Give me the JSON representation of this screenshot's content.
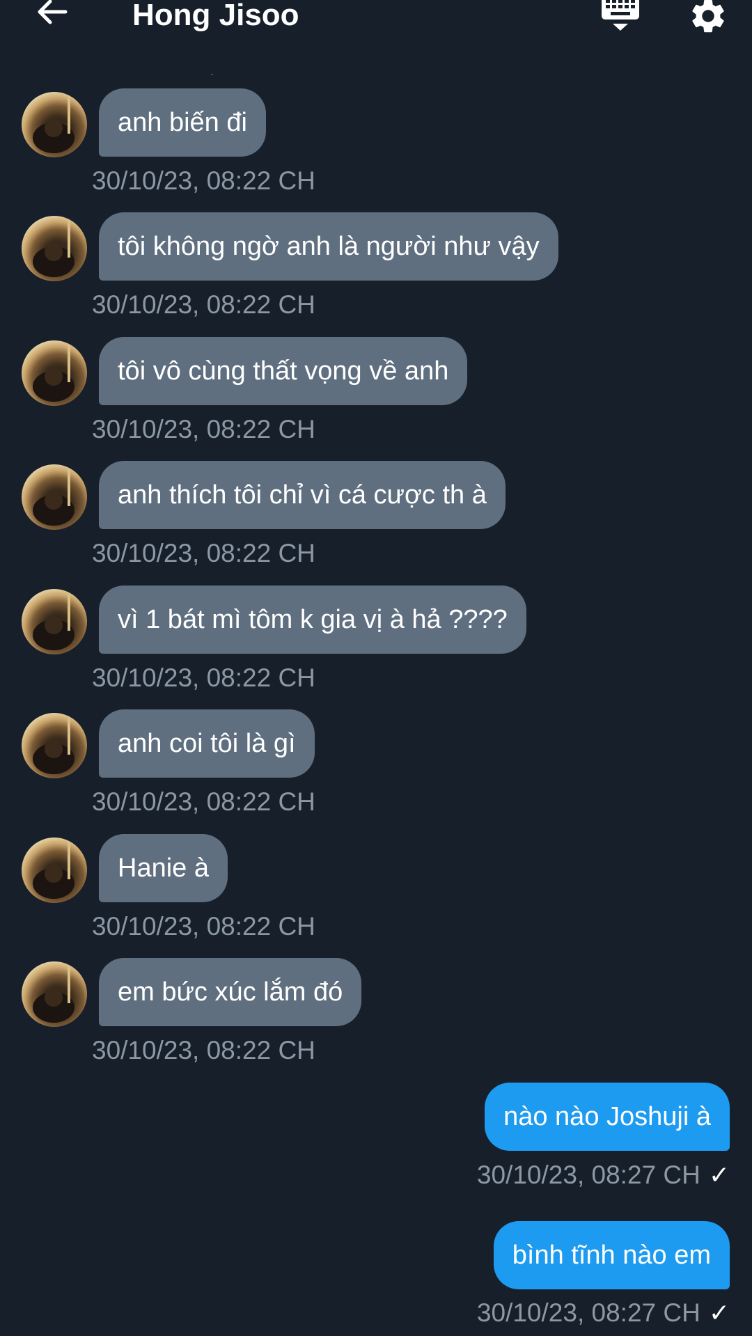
{
  "header": {
    "title": "Hong Jisoo"
  },
  "colors": {
    "background": "#17202a",
    "incoming_bubble": "#5f6f80",
    "outgoing_bubble": "#1d9bf0",
    "timestamp": "#8b98a5"
  },
  "icons": {
    "back": "arrow-left-icon",
    "keyboard": "keyboard-icon",
    "settings": "gear-icon",
    "read_receipt": "check-icon"
  },
  "messages": [
    {
      "direction": "in",
      "text": "anh biến đi",
      "time": "30/10/23, 08:22 CH"
    },
    {
      "direction": "in",
      "text": "tôi không ngờ anh là người như vậy",
      "time": "30/10/23, 08:22 CH"
    },
    {
      "direction": "in",
      "text": "tôi vô cùng thất vọng về anh",
      "time": "30/10/23, 08:22 CH"
    },
    {
      "direction": "in",
      "text": "anh thích tôi chỉ vì cá cược th à",
      "time": "30/10/23, 08:22 CH"
    },
    {
      "direction": "in",
      "text": "vì 1 bát mì tôm k gia vị à hả ????",
      "time": "30/10/23, 08:22 CH"
    },
    {
      "direction": "in",
      "text": "anh coi tôi là gì",
      "time": "30/10/23, 08:22 CH"
    },
    {
      "direction": "in",
      "text": "Hanie à",
      "time": "30/10/23, 08:22 CH"
    },
    {
      "direction": "in",
      "text": "em bức xúc lắm đó",
      "time": "30/10/23, 08:22 CH"
    },
    {
      "direction": "out",
      "text": "nào nào Joshuji à",
      "time": "30/10/23, 08:27 CH",
      "check": "✓"
    },
    {
      "direction": "out",
      "text": "bình tĩnh nào em",
      "time": "30/10/23, 08:27 CH",
      "check": "✓"
    }
  ]
}
